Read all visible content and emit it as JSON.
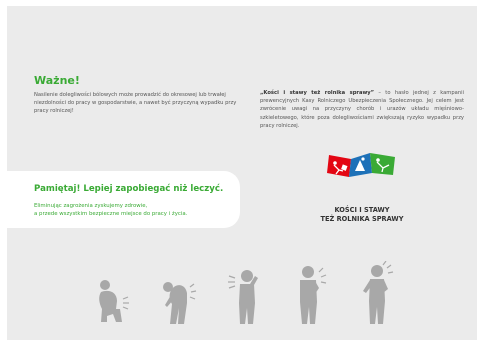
{
  "important": {
    "title": "Ważne!",
    "body": "Nasilenie dolegliwości bólowych może prowadzić do okresowej lub trwałej niezdolności do pracy w gospodarstwie, a nawet być przyczyną wypadku przy pracy rolniczej!"
  },
  "campaign": {
    "quote": "„Kości i stawy też rolnika sprawy”",
    "description": " – to hasło jednej z kampanii prewencyjnych Kasy Rolniczego Ubezpieczenia Społecznego. Jej celem jest zwrócenie uwagi na przyczyny chorób i urazów układu mięśniowo-szkieletowego, które poza dolegliwościami zwiększają ryzyko wypadku przy pracy rolniczej.",
    "title_line1": "KOŚCI I STAWY",
    "title_line2": "TEŻ ROLNIKA SPRAWY"
  },
  "callout": {
    "title": "Pamiętaj! Lepiej zapobiegać niż leczyć.",
    "line1": "Eliminując zagrożenia zyskujemy zdrowie,",
    "line2": "a przede wszystkim bezpieczne miejsce do pracy i życia."
  },
  "colors": {
    "accent_green": "#3aaa35",
    "logo_red": "#e30613",
    "logo_blue": "#1d71b8",
    "logo_green": "#3aaa35",
    "figure_gray": "#a8a8a8"
  },
  "icons": {
    "logo": "krus-campaign-logo",
    "figures": [
      "kneeling-person-back-pain-icon",
      "bent-person-back-pain-icon",
      "person-neck-pain-icon",
      "person-shoulder-pain-icon",
      "person-arm-pain-icon"
    ]
  }
}
